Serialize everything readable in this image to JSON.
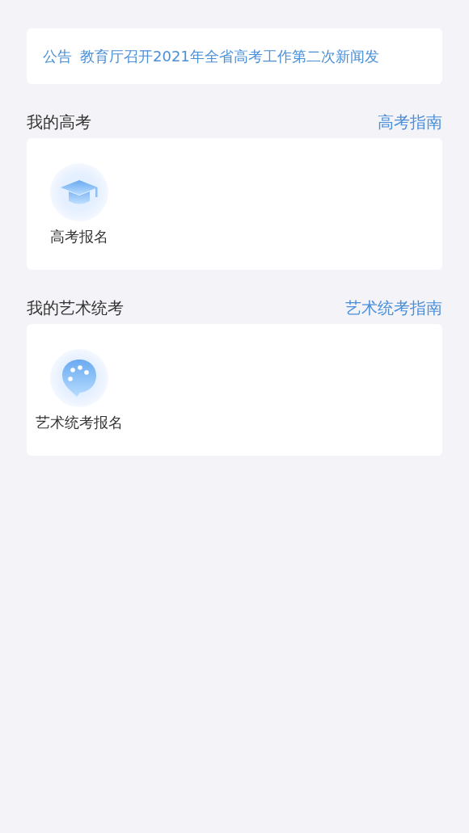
{
  "notice": {
    "label": "公告",
    "text": "教育厅召开2021年全省高考工作第二次新闻发"
  },
  "sections": [
    {
      "title": "我的高考",
      "link": "高考指南",
      "items": [
        {
          "kind": "cap",
          "label": "高考报名"
        }
      ]
    },
    {
      "title": "我的艺术统考",
      "link": "艺术统考指南",
      "items": [
        {
          "kind": "palette",
          "label": "艺术统考报名"
        }
      ]
    }
  ]
}
